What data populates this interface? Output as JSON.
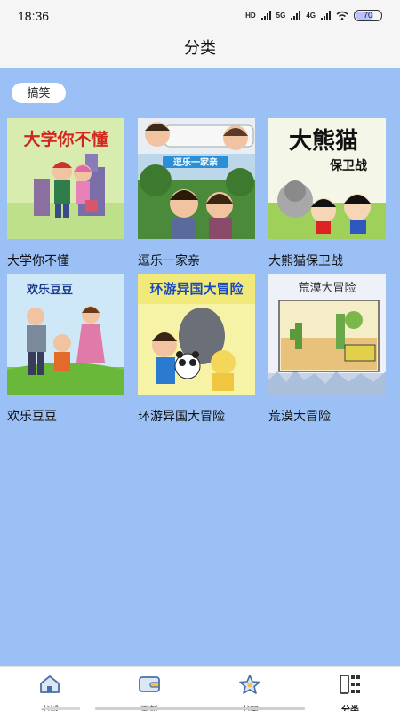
{
  "status_bar": {
    "time": "18:36",
    "net1": "HD",
    "net2": "5G",
    "net3": "4G",
    "battery": "70"
  },
  "header": {
    "title": "分类"
  },
  "tag": {
    "label": "搞笑"
  },
  "books": [
    {
      "title": "大学你不懂",
      "cover_text": "大学你不懂"
    },
    {
      "title": "逗乐一家亲",
      "cover_text": "逗乐一家亲"
    },
    {
      "title": "大熊猫保卫战",
      "cover_text": "大熊猫",
      "cover_text2": "保卫战"
    },
    {
      "title": "欢乐豆豆",
      "cover_text": "欢乐豆豆"
    },
    {
      "title": "环游异国大冒险",
      "cover_text": "环游异国大冒险"
    },
    {
      "title": "荒漠大冒险",
      "cover_text": "荒漠大冒险"
    }
  ],
  "tabs": [
    {
      "label": "书城",
      "icon": "home-icon"
    },
    {
      "label": "更新",
      "icon": "wallet-icon"
    },
    {
      "label": "书架",
      "icon": "star-icon"
    },
    {
      "label": "分类",
      "icon": "grid-icon"
    }
  ],
  "colors": {
    "content_bg": "#9ac0f6",
    "header_bg": "#f5f5f5",
    "tabbar_bg": "#ffffff"
  }
}
